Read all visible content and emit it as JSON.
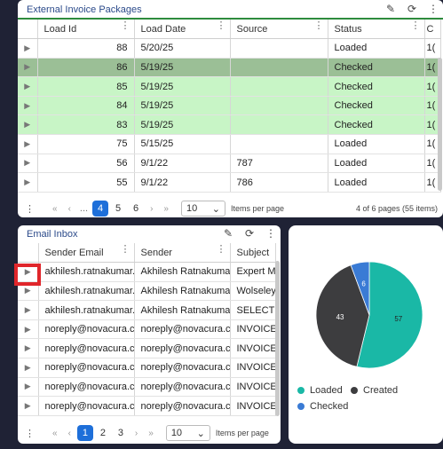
{
  "invoice_panel": {
    "title": "External Invoice Packages",
    "columns": [
      "Load Id",
      "Load Date",
      "Source",
      "Status",
      "C"
    ],
    "rows": [
      {
        "id": "88",
        "date": "5/20/25",
        "source": "",
        "status": "Loaded",
        "c": "1("
      },
      {
        "id": "86",
        "date": "5/19/25",
        "source": "",
        "status": "Checked",
        "c": "1("
      },
      {
        "id": "85",
        "date": "5/19/25",
        "source": "",
        "status": "Checked",
        "c": "1("
      },
      {
        "id": "84",
        "date": "5/19/25",
        "source": "",
        "status": "Checked",
        "c": "1("
      },
      {
        "id": "83",
        "date": "5/19/25",
        "source": "",
        "status": "Checked",
        "c": "1("
      },
      {
        "id": "75",
        "date": "5/15/25",
        "source": "",
        "status": "Loaded",
        "c": "1("
      },
      {
        "id": "56",
        "date": "9/1/22",
        "source": "787",
        "status": "Loaded",
        "c": "1("
      },
      {
        "id": "55",
        "date": "9/1/22",
        "source": "786",
        "status": "Loaded",
        "c": "1("
      }
    ],
    "pager": {
      "pages": [
        "4",
        "5",
        "6"
      ],
      "active": "4",
      "per_page": "10",
      "per_page_label": "Items per page",
      "info": "4 of 6 pages (55 items)",
      "ellipsis": "..."
    }
  },
  "email_panel": {
    "title": "Email Inbox",
    "columns": [
      "Sender Email",
      "Sender",
      "Subject"
    ],
    "rows": [
      {
        "email": "akhilesh.ratnakumar...",
        "sender": "Akhilesh Ratnakumar",
        "subject": "Expert Mo"
      },
      {
        "email": "akhilesh.ratnakumar...",
        "sender": "Akhilesh Ratnakumar",
        "subject": "Wolseley"
      },
      {
        "email": "akhilesh.ratnakumar...",
        "sender": "Akhilesh Ratnakumar",
        "subject": "SELECT EL"
      },
      {
        "email": "noreply@novacura.c...",
        "sender": "noreply@novacura.c...",
        "subject": "INVOICE T"
      },
      {
        "email": "noreply@novacura.c...",
        "sender": "noreply@novacura.c...",
        "subject": "INVOICE T"
      },
      {
        "email": "noreply@novacura.c...",
        "sender": "noreply@novacura.c...",
        "subject": "INVOICE T"
      },
      {
        "email": "noreply@novacura.c...",
        "sender": "noreply@novacura.c...",
        "subject": "INVOICE T"
      },
      {
        "email": "noreply@novacura.c...",
        "sender": "noreply@novacura.c...",
        "subject": "INVOICE T"
      }
    ],
    "pager": {
      "pages": [
        "1",
        "2",
        "3"
      ],
      "active": "1",
      "per_page": "10",
      "per_page_label": "Items per page"
    }
  },
  "chart_data": {
    "type": "pie",
    "labels": [
      "Loaded",
      "Created",
      "Checked"
    ],
    "values": [
      57,
      43,
      6
    ],
    "colors": [
      "#1ab8a6",
      "#3d3d3f",
      "#3a7bd5"
    ],
    "legend_position": "bottom"
  }
}
